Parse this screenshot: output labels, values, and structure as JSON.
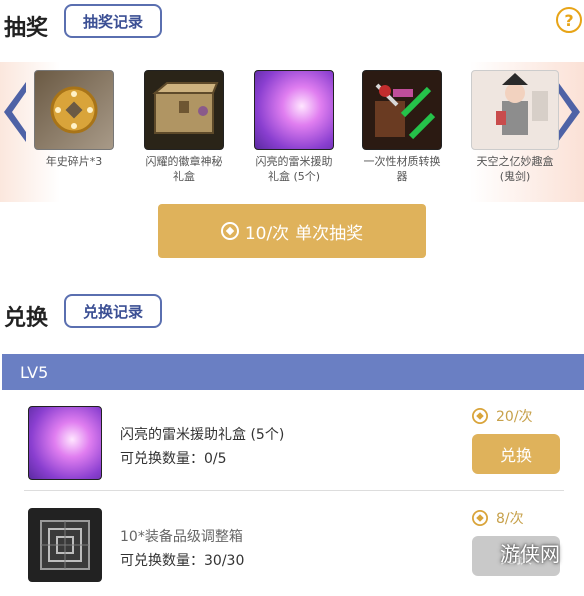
{
  "lottery": {
    "title": "抽奖",
    "record_label": "抽奖记录",
    "help_symbol": "?",
    "prizes": [
      {
        "caption": "年史碎片*3",
        "icon": "coin-icon"
      },
      {
        "caption": "闪耀的徽章神秘礼盒",
        "icon": "chest-icon"
      },
      {
        "caption": "闪亮的雷米援助礼盒 (5个)",
        "icon": "purple-box-icon"
      },
      {
        "caption": "一次性材质转换器",
        "icon": "converter-icon"
      },
      {
        "caption": "天空之亿妙趣盒(鬼剑)",
        "icon": "figure-icon"
      }
    ],
    "draw_cost": "10/次",
    "draw_label": "单次抽奖"
  },
  "exchange": {
    "title": "兑换",
    "record_label": "兑换记录",
    "level": "LV5",
    "items": [
      {
        "name": "闪亮的雷米援助礼盒 (5个)",
        "qty": "可兑换数量：0/5",
        "price": "20/次",
        "button": "兑换",
        "enabled": true
      },
      {
        "name": "10*装备品级调整箱",
        "qty": "可兑换数量：30/30",
        "price": "8/次",
        "button": "兑换",
        "enabled": false
      }
    ]
  },
  "watermark": "游侠网",
  "colors": {
    "accent": "#dfb25b",
    "level_bar": "#6a7fc3",
    "record_border": "#5a6fb0"
  }
}
